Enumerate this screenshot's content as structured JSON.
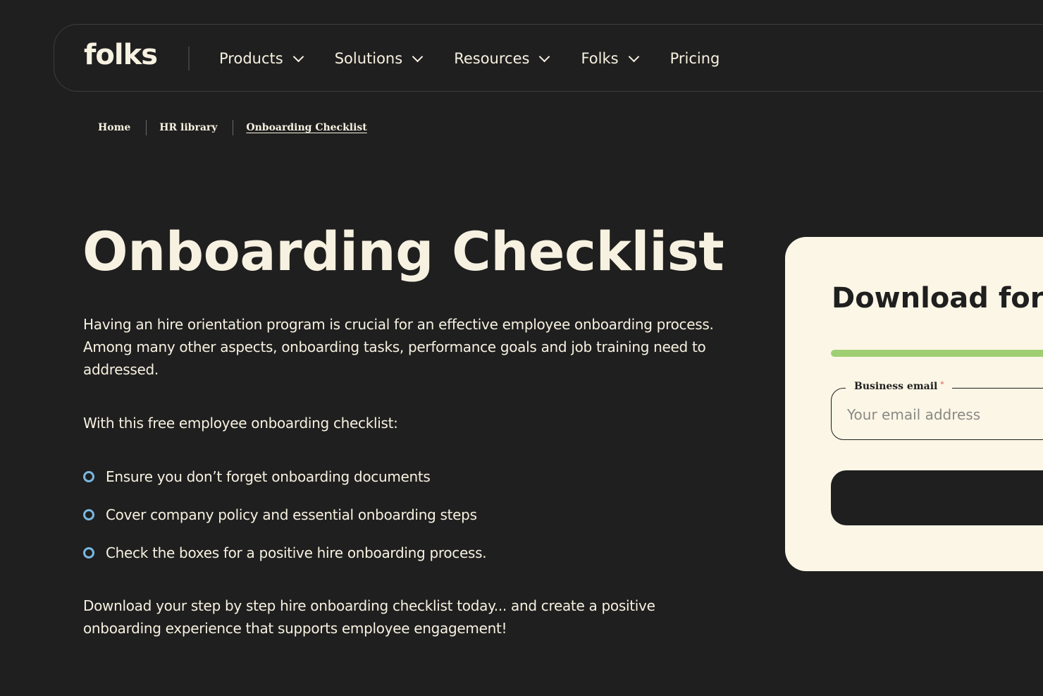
{
  "nav": {
    "logo": "folks",
    "items": [
      {
        "label": "Products"
      },
      {
        "label": "Solutions"
      },
      {
        "label": "Resources"
      },
      {
        "label": "Folks"
      },
      {
        "label": "Pricing"
      }
    ]
  },
  "breadcrumb": {
    "items": [
      "Home",
      "HR library",
      "Onboarding Checklist"
    ]
  },
  "hero": {
    "title": "Onboarding Checklist",
    "intro": "Having an hire orientation program is crucial for an effective employee onboarding process. Among many other aspects, onboarding tasks, performance goals and job training need to addressed.",
    "lead": "With this free employee onboarding checklist:",
    "bullets": [
      "Ensure you don’t forget onboarding documents",
      "Cover company policy and essential onboarding steps",
      "Check the boxes for a positive hire onboarding process."
    ],
    "outro": "Download your step by step hire onboarding checklist today... and create a positive onboarding experience that supports employee engagement!"
  },
  "form": {
    "title": "Download for",
    "progress_percent": 100,
    "email_label": "Business email",
    "email_required_mark": "*",
    "email_placeholder": "Your email address",
    "email_value": ""
  },
  "colors": {
    "background": "#1f1f1f",
    "text": "#f7f1e1",
    "card": "#fcf6e6",
    "accent_progress": "#9fcf72",
    "bullet": "#7ab8e0"
  }
}
